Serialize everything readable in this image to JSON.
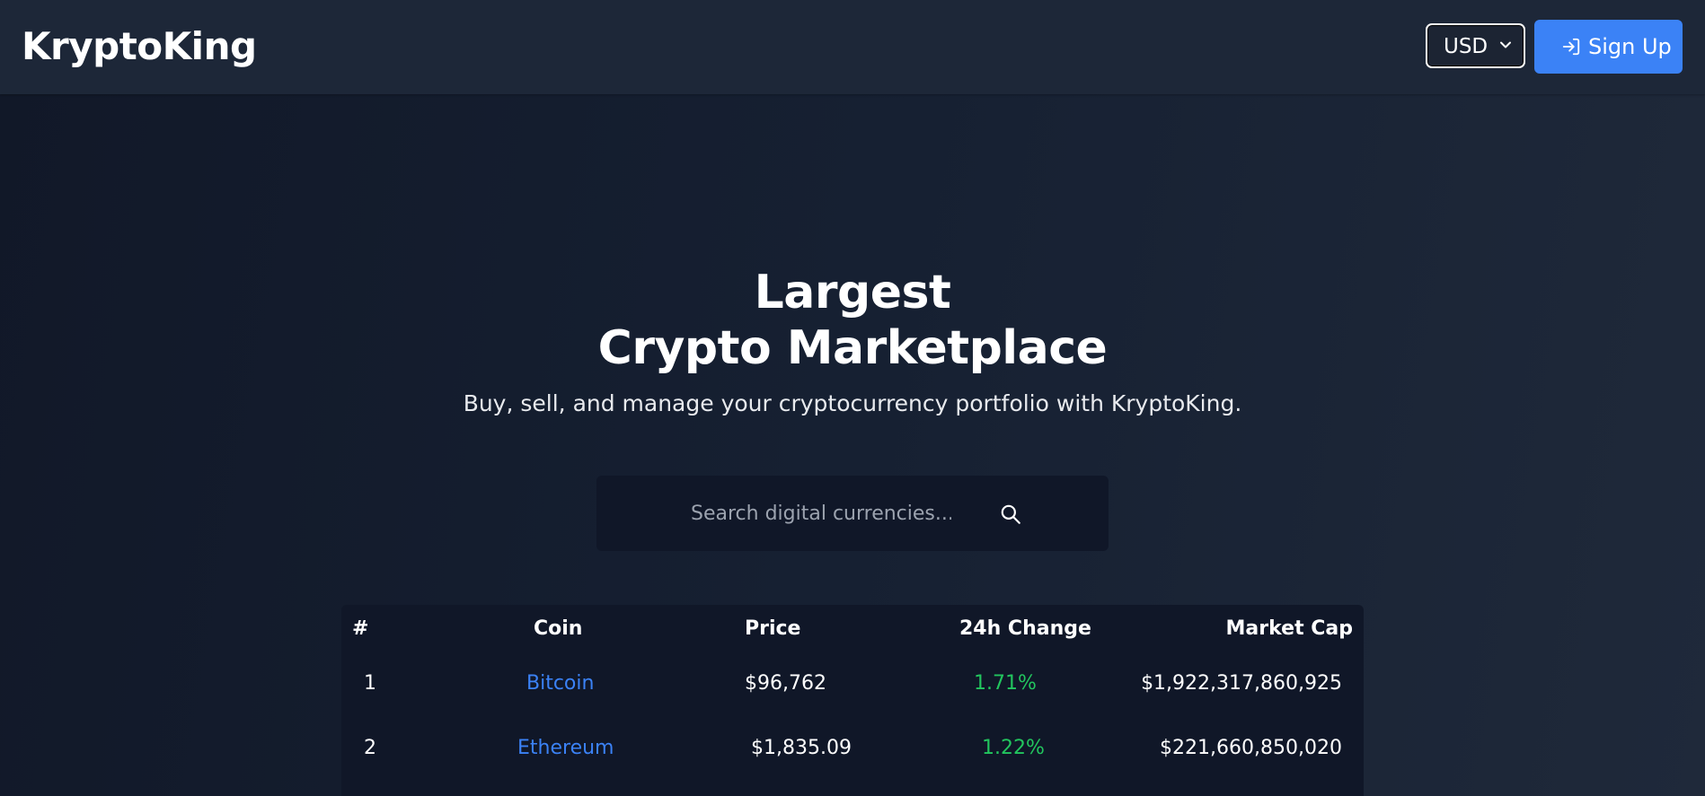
{
  "header": {
    "logo": "KryptoKing",
    "currency": "USD",
    "signup_label": "Sign Up"
  },
  "hero": {
    "title_line1": "Largest",
    "title_line2": "Crypto Marketplace",
    "subtitle": "Buy, sell, and manage your cryptocurrency portfolio with KryptoKing."
  },
  "search": {
    "placeholder": "Search digital currencies..."
  },
  "table": {
    "headers": {
      "rank": "#",
      "coin": "Coin",
      "price": "Price",
      "change": "24h Change",
      "market_cap": "Market Cap"
    },
    "rows": [
      {
        "rank": "1",
        "coin": "Bitcoin",
        "price": "$96,762",
        "change": "1.71%",
        "market_cap": "$1,922,317,860,925"
      },
      {
        "rank": "2",
        "coin": "Ethereum",
        "price": "$1,835.09",
        "change": "1.22%",
        "market_cap": "$221,660,850,020"
      }
    ]
  },
  "colors": {
    "accent": "#3b82f6",
    "positive": "#22c55e",
    "navbar": "#1d2738",
    "panel": "#101728"
  },
  "icons": {
    "signup": "login-icon",
    "search": "search-icon",
    "select": "chevron-down-icon"
  }
}
